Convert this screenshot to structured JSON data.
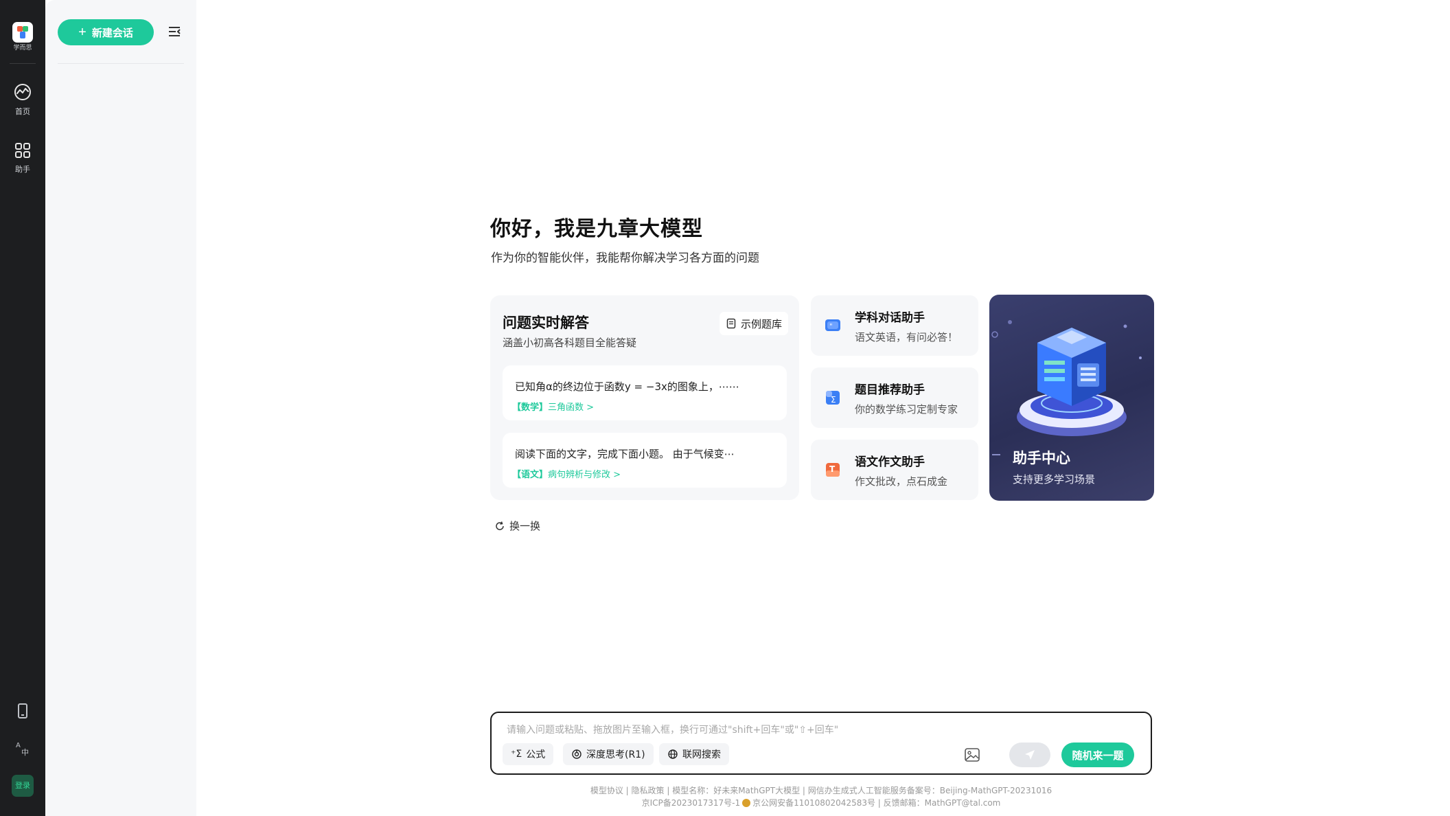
{
  "rail": {
    "brand": "学而思",
    "home_label": "首页",
    "assistant_label": "助手",
    "login_label": "登录"
  },
  "sidebar": {
    "new_chat_label": "新建会话"
  },
  "main": {
    "greeting": "你好，我是九章大模型",
    "subtitle": "作为你的智能伙伴，我能帮你解决学习各方面的问题",
    "qa": {
      "title": "问题实时解答",
      "subtitle": "涵盖小初高各科题目全能答疑",
      "example_bank_label": "示例题库",
      "questions": [
        {
          "text": "已知角α的终边位于函数y = −3x的图象上，⋯⋯",
          "tag": "【数学】",
          "topic": "三角函数 >"
        },
        {
          "text": "阅读下面的文字，完成下面小题。 由于气候变⋯",
          "tag": "【语文】",
          "topic": "病句辨析与修改 >"
        }
      ],
      "refresh_label": "换一换"
    },
    "assistants": [
      {
        "title": "学科对话助手",
        "desc": "语文英语，有问必答！",
        "icon": "chat-icon",
        "color": "#3b7ff5"
      },
      {
        "title": "题目推荐助手",
        "desc": "你的数学练习定制专家",
        "icon": "sigma-icon",
        "color": "#3b7ff5"
      },
      {
        "title": "语文作文助手",
        "desc": "作文批改，点石成金",
        "icon": "essay-icon",
        "color": "#f06a3e"
      }
    ],
    "hub": {
      "title": "助手中心",
      "desc": "支持更多学习场景"
    }
  },
  "composer": {
    "placeholder": "请输入问题或粘贴、拖放图片至输入框，换行可通过\"shift+回车\"或\"⇧+回车\"",
    "formula_label": "公式",
    "deep_think_label": "深度思考(R1)",
    "web_search_label": "联网搜索",
    "random_label": "随机来一题"
  },
  "footer": {
    "line1": "模型协议 | 隐私政策 | 模型名称：好未来MathGPT大模型 | 网信办生成式人工智能服务备案号：Beijing-MathGPT-20231016",
    "line2_a": "京ICP备2023017317号-1",
    "line2_b": "京公网安备11010802042583号 | 反馈邮箱：MathGPT@tal.com"
  },
  "colors": {
    "accent": "#1ec99b",
    "rail_bg": "#1d1e20",
    "hub_bg": "#2b2f57"
  }
}
